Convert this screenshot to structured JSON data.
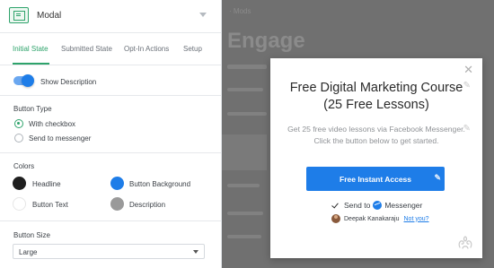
{
  "panel": {
    "type_label": "Modal",
    "tabs": [
      {
        "label": "Initial State",
        "active": true
      },
      {
        "label": "Submitted State",
        "active": false
      },
      {
        "label": "Opt-In Actions",
        "active": false
      },
      {
        "label": "Setup",
        "active": false
      }
    ],
    "show_description": {
      "label": "Show Description",
      "on": true
    },
    "button_type": {
      "title": "Button Type",
      "options": [
        {
          "label": "With checkbox",
          "checked": true
        },
        {
          "label": "Send to messenger",
          "checked": false
        }
      ]
    },
    "colors": {
      "title": "Colors",
      "items": [
        {
          "label": "Headline",
          "color": "#1f1f1f"
        },
        {
          "label": "Button Background",
          "color": "#1e7de8"
        },
        {
          "label": "Button Text",
          "color": "#ffffff"
        },
        {
          "label": "Description",
          "color": "#9a9a9a"
        }
      ]
    },
    "button_size": {
      "title": "Button Size",
      "value": "Large"
    }
  },
  "preview": {
    "bg_text_small": "· Mods",
    "bg_text_large": "Engage",
    "modal": {
      "headline": "Free Digital Marketing Course (25 Free Lessons)",
      "description": "Get 25 free video lessons via Facebook Messenger. Click the button below to get started.",
      "button_label": "Free Instant Access",
      "send_to_label": "Send to",
      "messenger_label": "Messenger",
      "user_name": "Deepak Kanakaraju",
      "not_you_label": "Not you?"
    }
  },
  "theme": {
    "accent": "#2ea36b",
    "primary": "#1e7de8",
    "overlay": "#707070"
  }
}
